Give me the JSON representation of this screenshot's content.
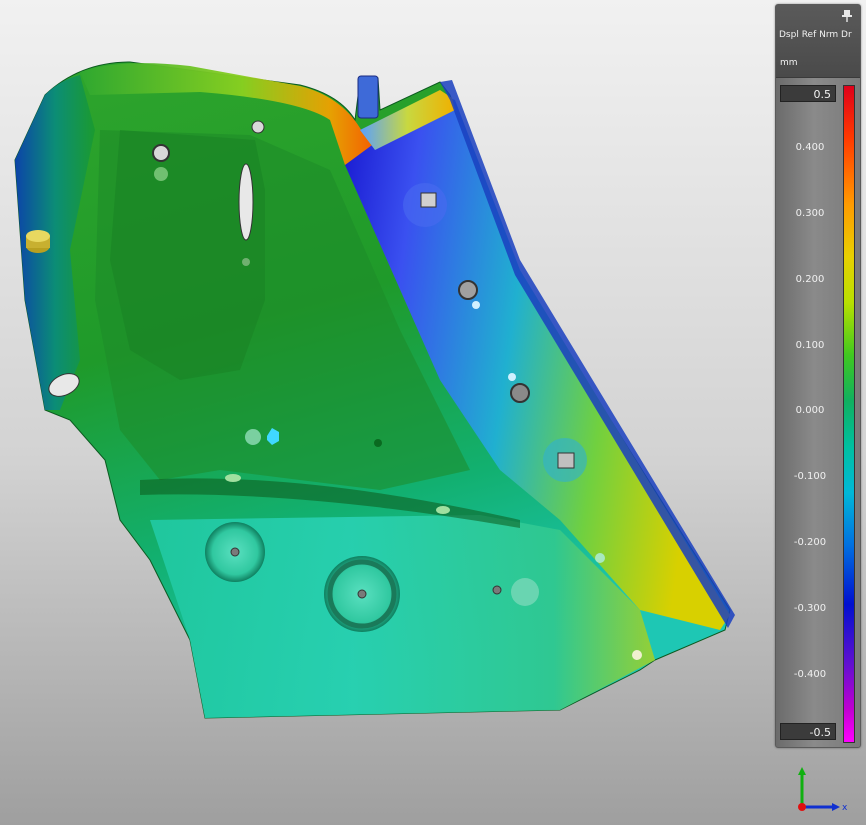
{
  "legend": {
    "title": "Dspl Ref Nrm Dr",
    "unit": "mm",
    "max_value": "0.5",
    "min_value": "-0.5",
    "ticks": [
      "0.400",
      "0.300",
      "0.200",
      "0.100",
      "0.000",
      "-0.100",
      "-0.200",
      "-0.300",
      "-0.400"
    ]
  },
  "axes": {
    "x_label": "x"
  },
  "icons": {
    "pin": "pin-icon",
    "triad": "axis-triad-icon"
  }
}
